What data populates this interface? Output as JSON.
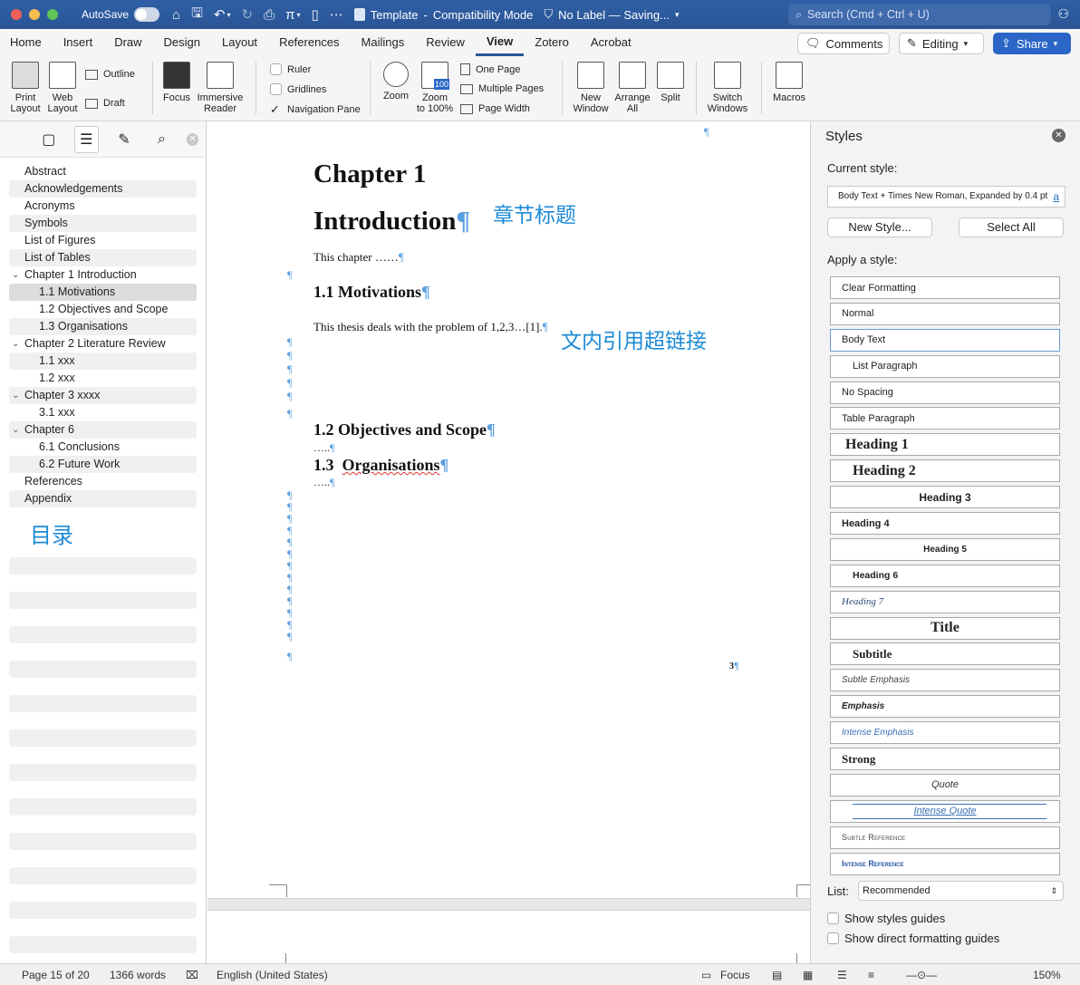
{
  "titlebar": {
    "autosave_label": "AutoSave",
    "doc_name": "Template",
    "separator": "-",
    "mode": "Compatibility Mode",
    "sensitivity": "No Label — Saving...",
    "search_placeholder": "Search (Cmd + Ctrl + U)"
  },
  "tabs": [
    "Home",
    "Insert",
    "Draw",
    "Design",
    "Layout",
    "References",
    "Mailings",
    "Review",
    "View",
    "Zotero",
    "Acrobat"
  ],
  "ribbon_actions": {
    "comments": "Comments",
    "editing": "Editing",
    "share": "Share"
  },
  "ribbon": {
    "print_layout": [
      "Print",
      "Layout"
    ],
    "web_layout": [
      "Web",
      "Layout"
    ],
    "outline": "Outline",
    "draft": "Draft",
    "focus": "Focus",
    "immersive": [
      "Immersive",
      "Reader"
    ],
    "ruler": "Ruler",
    "gridlines": "Gridlines",
    "navigation_pane": "Navigation Pane",
    "zoom": "Zoom",
    "zoom100": [
      "Zoom",
      "to 100%"
    ],
    "zoom100_badge": "100",
    "one_page": "One Page",
    "multiple_pages": "Multiple Pages",
    "page_width": "Page Width",
    "new_window": [
      "New",
      "Window"
    ],
    "arrange_all": [
      "Arrange",
      "All"
    ],
    "split": "Split",
    "switch_windows": [
      "Switch",
      "Windows"
    ],
    "macros": "Macros"
  },
  "nav": {
    "items": [
      {
        "label": "Abstract",
        "level": 0,
        "shade": false
      },
      {
        "label": "Acknowledgements",
        "level": 0,
        "shade": true
      },
      {
        "label": "Acronyms",
        "level": 0,
        "shade": false
      },
      {
        "label": "Symbols",
        "level": 0,
        "shade": true
      },
      {
        "label": "List of Figures",
        "level": 0,
        "shade": false
      },
      {
        "label": "List of Tables",
        "level": 0,
        "shade": true
      },
      {
        "label": "Chapter 1 Introduction",
        "level": 0,
        "shade": false,
        "expanded": true
      },
      {
        "label": "1.1 Motivations",
        "level": 1,
        "selected": true
      },
      {
        "label": "1.2 Objectives and Scope",
        "level": 1,
        "shade": false
      },
      {
        "label": "1.3 Organisations",
        "level": 1,
        "shade": true
      },
      {
        "label": "Chapter 2 Literature Review",
        "level": 0,
        "shade": false,
        "expanded": true
      },
      {
        "label": "1.1 xxx",
        "level": 1,
        "shade": true
      },
      {
        "label": "1.2 xxx",
        "level": 1,
        "shade": false
      },
      {
        "label": "Chapter 3 xxxx",
        "level": 0,
        "shade": true,
        "expanded": true
      },
      {
        "label": "3.1 xxx",
        "level": 1,
        "shade": false
      },
      {
        "label": "Chapter 6",
        "level": 0,
        "shade": true,
        "expanded": true
      },
      {
        "label": "6.1 Conclusions",
        "level": 1,
        "shade": false
      },
      {
        "label": "6.2 Future Work",
        "level": 1,
        "shade": true
      },
      {
        "label": "References",
        "level": 0,
        "shade": false
      },
      {
        "label": "Appendix",
        "level": 0,
        "shade": true
      }
    ],
    "annotation": "目录"
  },
  "document": {
    "chapter": "Chapter 1",
    "title": "Introduction",
    "title_annotation": "章节标题",
    "intro_text": "This chapter ……",
    "h11": "1.1  Motivations",
    "body": "This thesis deals with the problem of 1,2,3…[1].",
    "body_annotation": "文内引用超链接",
    "h12": "1.2  Objectives and Scope",
    "dots1": "…..",
    "h13_num": "1.3",
    "h13_text": "Organisations",
    "dots2": "…..",
    "page_number": "3",
    "pilcrow": "¶"
  },
  "styles_pane": {
    "title": "Styles",
    "current_label": "Current style:",
    "current_value": "Body Text + Times New Roman, Expanded by  0.4 pt",
    "new_style": "New Style...",
    "select_all": "Select All",
    "apply_label": "Apply a style:",
    "styles": [
      "Clear Formatting",
      "Normal",
      "Body Text",
      "List Paragraph",
      "No Spacing",
      "Table Paragraph",
      "Heading 1",
      "Heading 2",
      "Heading 3",
      "Heading 4",
      "Heading 5",
      "Heading 6",
      "Heading 7",
      "Title",
      "Subtitle",
      "Subtle Emphasis",
      "Emphasis",
      "Intense Emphasis",
      "Strong",
      "Quote",
      "Intense Quote",
      "Subtle Reference",
      "Intense Reference"
    ],
    "list_label": "List:",
    "list_value": "Recommended",
    "show_guides": "Show styles guides",
    "show_direct": "Show direct formatting guides"
  },
  "status": {
    "page": "Page 15 of 20",
    "words": "1366 words",
    "language": "English (United States)",
    "focus": "Focus",
    "zoom": "150%"
  },
  "colors": {
    "titlebar": "#2b5797",
    "accent": "#2b66c7",
    "annotation": "#1d8ad6",
    "pilcrow": "#5aa0e0"
  }
}
